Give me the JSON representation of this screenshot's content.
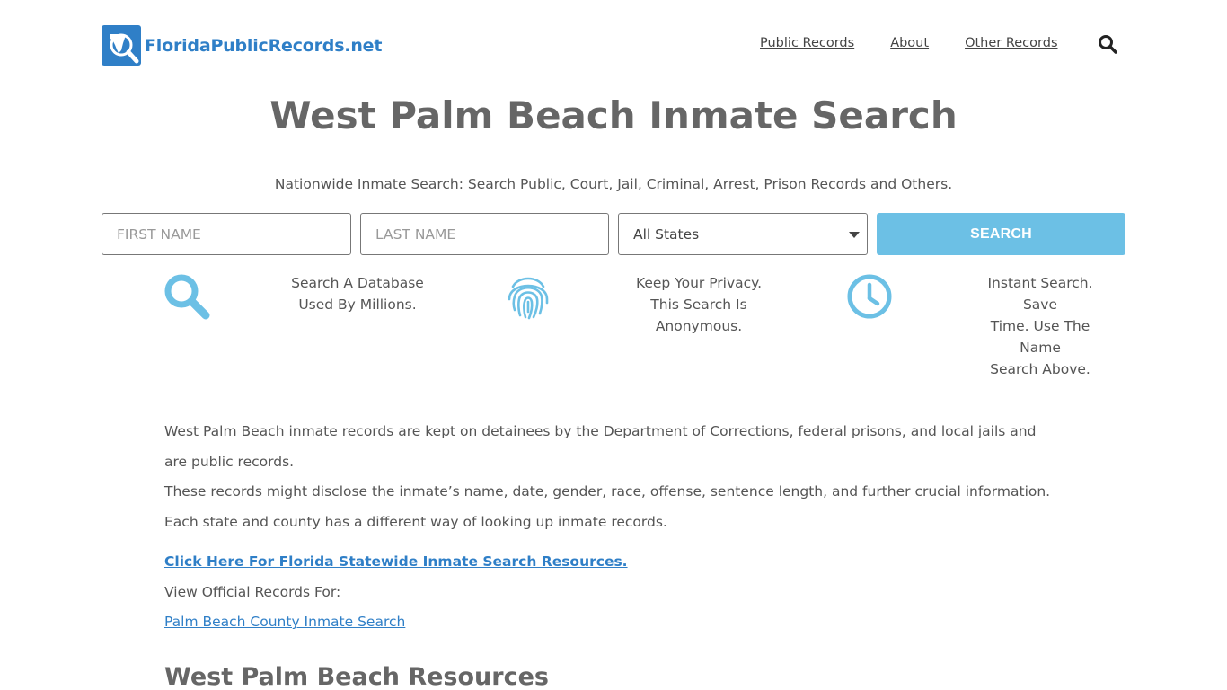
{
  "header": {
    "logo_text": "FloridaPublicRecords.net",
    "nav": [
      {
        "label": "Public Records"
      },
      {
        "label": "About"
      },
      {
        "label": "Other Records"
      }
    ],
    "search_icon": "search-icon"
  },
  "page": {
    "title": "West Palm Beach Inmate Search",
    "subtitle": "Nationwide Inmate Search: Search Public, Court, Jail, Criminal, Arrest, Prison Records and Others."
  },
  "form": {
    "first_name_placeholder": "FIRST NAME",
    "first_name_value": "",
    "last_name_placeholder": "LAST NAME",
    "last_name_value": "",
    "state_selected": "All States",
    "search_label": "SEARCH",
    "accent_color": "#6cc0e5"
  },
  "features": [
    {
      "icon": "magnifier-icon",
      "line1": "Search A Database",
      "line2": "Used By Millions.",
      "line3": ""
    },
    {
      "icon": "fingerprint-icon",
      "line1": "Keep Your Privacy.",
      "line2": "This Search Is",
      "line3": "Anonymous."
    },
    {
      "icon": "clock-icon",
      "line1": "Instant Search. Save",
      "line2": "Time. Use The Name",
      "line3": "Search Above."
    }
  ],
  "content": {
    "para1": "West Palm Beach inmate records are kept on detainees by the Department of Corrections, federal prisons, and local jails and are public records.",
    "para2": "These records might disclose the inmate’s name, date, gender, race, offense, sentence length, and further crucial information. Each state and county has a different way of looking up inmate records.",
    "statewide_link": "Click Here For Florida Statewide Inmate Search Resources.",
    "view_official": "View Official Records For:",
    "county_link": "Palm Beach County Inmate Search",
    "resources_heading": "West Palm Beach Resources"
  }
}
